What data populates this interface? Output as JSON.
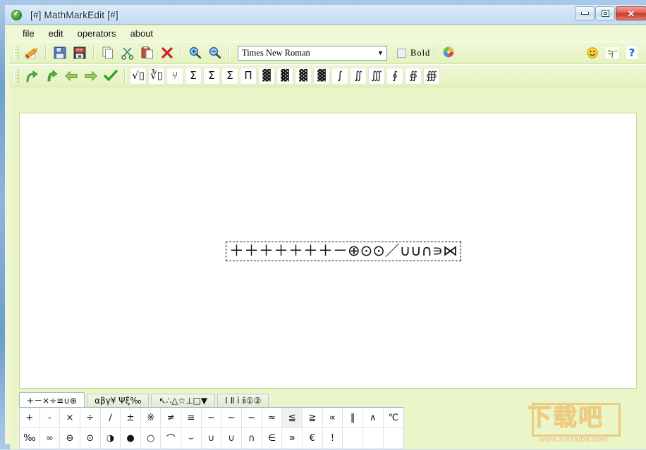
{
  "window": {
    "title": "[#] MathMarkEdit [#]",
    "app_icon": "green-check-circle-icon",
    "controls": {
      "minimize": "minimize-button",
      "maximize": "restore-button",
      "close": "close-button",
      "close_glyph": "✕"
    }
  },
  "menubar": {
    "items": [
      {
        "label": "file"
      },
      {
        "label": "edit"
      },
      {
        "label": "operators"
      },
      {
        "label": "about"
      }
    ]
  },
  "toolbar_main": {
    "buttons": [
      {
        "name": "edit-pencil-button",
        "glyph": "✎",
        "title": "edit"
      },
      {
        "name": "save-button",
        "glyph": "💾",
        "title": "save"
      },
      {
        "name": "export-pdf-button",
        "glyph": "PDF",
        "title": "export pdf"
      },
      {
        "name": "copy-button",
        "glyph": "❐",
        "title": "copy"
      },
      {
        "name": "cut-button",
        "glyph": "✂",
        "title": "cut"
      },
      {
        "name": "paste-button",
        "glyph": "📋",
        "title": "paste"
      },
      {
        "name": "delete-button",
        "glyph": "✕",
        "title": "delete"
      },
      {
        "name": "zoom-in-button",
        "glyph": "🔍",
        "title": "zoom in"
      },
      {
        "name": "zoom-out-button",
        "glyph": "🔍",
        "title": "zoom out"
      }
    ],
    "font_select": {
      "value": "Times New Roman",
      "arrow": "▼"
    },
    "bold_checkbox": {
      "label": "Bold",
      "checked": false
    },
    "color_button": {
      "name": "color-palette-button"
    },
    "right_buttons": [
      {
        "name": "smiley-button",
        "glyph": "☺"
      },
      {
        "name": "plant-button",
        "glyph": "⸙"
      },
      {
        "name": "help-button",
        "glyph": "?"
      }
    ]
  },
  "toolbar_operators": {
    "nav_buttons": [
      {
        "name": "undo-button",
        "glyph": "↶"
      },
      {
        "name": "redo-button",
        "glyph": "↷"
      },
      {
        "name": "back-button",
        "glyph": "⇐"
      },
      {
        "name": "forward-button",
        "glyph": "⇒"
      },
      {
        "name": "confirm-button",
        "glyph": "✔"
      }
    ],
    "symbol_buttons": [
      {
        "name": "sqrt-button",
        "glyph": "√▯"
      },
      {
        "name": "nth-root-button",
        "glyph": "∛▯"
      },
      {
        "name": "fraction-button",
        "glyph": "⑂"
      },
      {
        "name": "sum-button",
        "glyph": "Σ"
      },
      {
        "name": "sum-limits-button",
        "glyph": "Σ"
      },
      {
        "name": "sum-big-button",
        "glyph": "Σ"
      },
      {
        "name": "product-button",
        "glyph": "Π"
      },
      {
        "name": "matrix-button",
        "glyph": "▓"
      },
      {
        "name": "matrix-2-button",
        "glyph": "▓"
      },
      {
        "name": "matrix-3-button",
        "glyph": "▓"
      },
      {
        "name": "matrix-4-button",
        "glyph": "▓"
      },
      {
        "name": "integral-button",
        "glyph": "∫"
      },
      {
        "name": "double-integral-button",
        "glyph": "∬"
      },
      {
        "name": "triple-integral-button",
        "glyph": "∭"
      },
      {
        "name": "contour-integral-button",
        "glyph": "∮"
      },
      {
        "name": "surface-integral-button",
        "glyph": "∯"
      },
      {
        "name": "volume-integral-button",
        "glyph": "∰"
      }
    ]
  },
  "editor": {
    "formula": "＋＋＋＋＋＋＋－⊕⊙⊙／∪∪∩∍⋈"
  },
  "palette": {
    "tabs": [
      {
        "label": "+－×÷≅∪⊕",
        "active": true,
        "name": "tab-operators"
      },
      {
        "label": "αβγ¥ Ψξ‰",
        "active": false,
        "name": "tab-greek"
      },
      {
        "label": "↖∴△☆⊥□▼",
        "active": false,
        "name": "tab-shapes"
      },
      {
        "label": "Ⅰ Ⅱ ⅰ ⅱ①②",
        "active": false,
        "name": "tab-numerals"
      }
    ],
    "rows": [
      {
        "cells": [
          {
            "glyph": "+",
            "highlight": false
          },
          {
            "glyph": "-",
            "highlight": false
          },
          {
            "glyph": "×",
            "highlight": false
          },
          {
            "glyph": "÷",
            "highlight": false
          },
          {
            "glyph": "∕",
            "highlight": false
          },
          {
            "glyph": "±",
            "highlight": false
          },
          {
            "glyph": "※",
            "highlight": false
          },
          {
            "glyph": "≠",
            "highlight": false
          },
          {
            "glyph": "≅",
            "highlight": false
          },
          {
            "glyph": "∼",
            "highlight": false
          },
          {
            "glyph": "∼",
            "highlight": false
          },
          {
            "glyph": "~",
            "highlight": false
          },
          {
            "glyph": "≈",
            "highlight": false
          },
          {
            "glyph": "≦",
            "highlight": true
          },
          {
            "glyph": "≧",
            "highlight": false
          },
          {
            "glyph": "∝",
            "highlight": false
          },
          {
            "glyph": "‖",
            "highlight": false
          },
          {
            "glyph": "∧",
            "highlight": false
          },
          {
            "glyph": "℃",
            "highlight": false
          }
        ]
      },
      {
        "cells": [
          {
            "glyph": "‰",
            "highlight": false
          },
          {
            "glyph": "∞",
            "highlight": false
          },
          {
            "glyph": "⊖",
            "highlight": false
          },
          {
            "glyph": "⊙",
            "highlight": false
          },
          {
            "glyph": "◑",
            "highlight": false
          },
          {
            "glyph": "●",
            "highlight": false
          },
          {
            "glyph": "○",
            "highlight": false
          },
          {
            "glyph": "⌒",
            "highlight": false
          },
          {
            "glyph": "⌣",
            "highlight": false
          },
          {
            "glyph": "∪",
            "highlight": false
          },
          {
            "glyph": "∪",
            "highlight": false
          },
          {
            "glyph": "∩",
            "highlight": false
          },
          {
            "glyph": "∈",
            "highlight": false
          },
          {
            "glyph": "∍",
            "highlight": false
          },
          {
            "glyph": "€",
            "highlight": false
          },
          {
            "glyph": "!",
            "highlight": false
          },
          {
            "glyph": "",
            "highlight": false
          },
          {
            "glyph": "",
            "highlight": false
          },
          {
            "glyph": "",
            "highlight": false
          }
        ]
      }
    ]
  },
  "watermark": {
    "text": "下载吧",
    "url": "www.xiazaiba.com"
  }
}
